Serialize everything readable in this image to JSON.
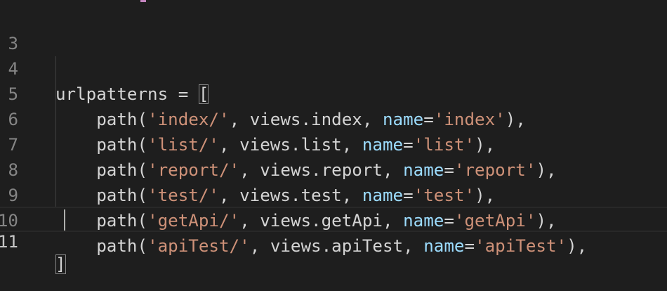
{
  "editor": {
    "background": "#1e1e1e",
    "colors": {
      "string": "#ce9178",
      "keyword_arg": "#9cdcfe",
      "default": "#d4d4d4",
      "line_number": "#858585"
    },
    "cursor_line": 11,
    "lines": [
      {
        "number": "3",
        "code": ""
      },
      {
        "number": "4",
        "code": "urlpatterns = []"
      },
      {
        "number": "5",
        "code": "    path('index/', views.index, name='index'),"
      },
      {
        "number": "6",
        "code": "    path('list/', views.list, name='list'),"
      },
      {
        "number": "7",
        "code": "    path('report/', views.report, name='report'),"
      },
      {
        "number": "8",
        "code": "    path('test/', views.test, name='test'),"
      },
      {
        "number": "9",
        "code": "    path('getApi/', views.getApi, name='getApi'),"
      },
      {
        "number": "10",
        "code": "    path('apiTest/', views.apiTest, name='apiTest'),"
      },
      {
        "number": "11",
        "code": "]"
      }
    ],
    "tokens": {
      "l4": {
        "ident": "urlpatterns",
        "op": " = ",
        "open": "["
      },
      "path_fn": "path",
      "rows": [
        {
          "route": "'index/'",
          "view": "views.index",
          "kw": "name",
          "name": "'index'"
        },
        {
          "route": "'list/'",
          "view": "views.list",
          "kw": "name",
          "name": "'list'"
        },
        {
          "route": "'report/'",
          "view": "views.report",
          "kw": "name",
          "name": "'report'"
        },
        {
          "route": "'test/'",
          "view": "views.test",
          "kw": "name",
          "name": "'test'"
        },
        {
          "route": "'getApi/'",
          "view": "views.getApi",
          "kw": "name",
          "name": "'getApi'"
        },
        {
          "route": "'apiTest/'",
          "view": "views.apiTest",
          "kw": "name",
          "name": "'apiTest'"
        }
      ],
      "close": "]"
    }
  }
}
